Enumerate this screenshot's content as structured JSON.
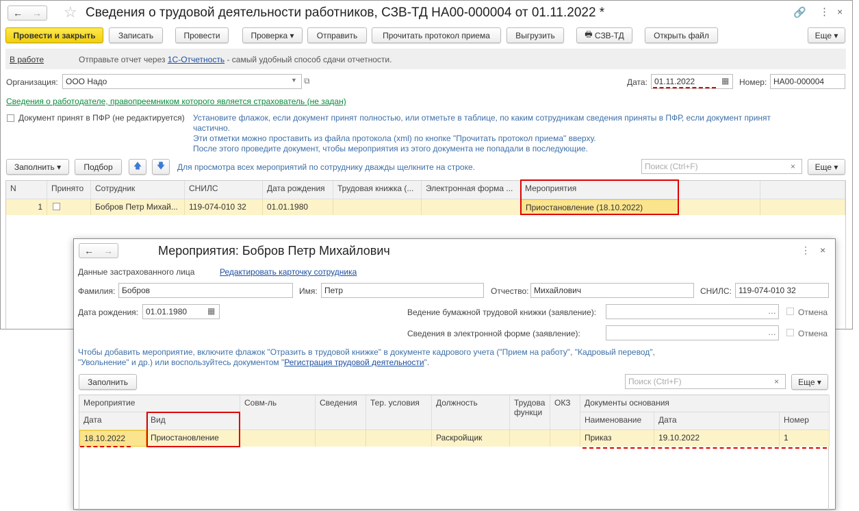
{
  "window": {
    "title": "Сведения о трудовой деятельности работников, СЗВ-ТД НА00-000004 от 01.11.2022 *"
  },
  "toolbar": {
    "post_close": "Провести и закрыть",
    "save": "Записать",
    "post": "Провести",
    "check": "Проверка",
    "send": "Отправить",
    "read_protocol": "Прочитать протокол приема",
    "upload": "Выгрузить",
    "print": "СЗВ-ТД",
    "open_file": "Открыть файл",
    "more": "Еще"
  },
  "status": {
    "state": "В работе",
    "msg_pre": "Отправьте отчет через",
    "msg_link": "1С-Отчетность",
    "msg_post": "- самый удобный способ сдачи отчетности."
  },
  "form": {
    "org_label": "Организация:",
    "org_value": "ООО Надо",
    "date_label": "Дата:",
    "date_value": "01.11.2022",
    "num_label": "Номер:",
    "num_value": "НА00-000004",
    "employer_link": "Сведения о работодателе, правопреемником которого является страхователь (не задан)",
    "accepted_label": "Документ принят в ПФР (не редактируется)",
    "hint1": "Установите флажок, если документ принят полностью, или отметьте в таблице, по каким сотрудникам сведения приняты в ПФР, если документ принят",
    "hint1b": "частично.",
    "hint2": "Эти отметки можно проставить из файла протокола (xml) по кнопке \"Прочитать протокол приема\" вверху.",
    "hint3": "После этого проведите документ, чтобы мероприятия из этого документа не попадали в последующие."
  },
  "table_toolbar": {
    "fill": "Заполнить",
    "select": "Подбор",
    "hint": "Для просмотра всех мероприятий по сотруднику дважды щелкните на строке.",
    "search_placeholder": "Поиск (Ctrl+F)",
    "more": "Еще"
  },
  "table": {
    "headers": [
      "N",
      "Принято",
      "Сотрудник",
      "СНИЛС",
      "Дата рождения",
      "Трудовая книжка (...",
      "Электронная форма ...",
      "Мероприятия"
    ],
    "rows": [
      {
        "n": "1",
        "employee": "Бобров Петр Михай...",
        "snils": "119-074-010 32",
        "birth": "01.01.1980",
        "book": "",
        "eform": "",
        "events": "Приостановление (18.10.2022)"
      }
    ]
  },
  "dialog": {
    "title": "Мероприятия: Бобров Петр Михайлович",
    "section": "Данные застрахованного лица",
    "edit_link": "Редактировать карточку сотрудника",
    "surname_label": "Фамилия:",
    "surname": "Бобров",
    "name_label": "Имя:",
    "name": "Петр",
    "patronymic_label": "Отчество:",
    "patronymic": "Михайлович",
    "snils_label": "СНИЛС:",
    "snils": "119-074-010 32",
    "birth_label": "Дата рождения:",
    "birth": "01.01.1980",
    "paper_label": "Ведение бумажной трудовой книжки (заявление):",
    "eform_label": "Сведения в электронной форме (заявление):",
    "cancel": "Отмена",
    "hint_a": "Чтобы добавить мероприятие, включите флажок \"Отразить в трудовой книжке\" в документе кадрового учета (\"Прием на работу\", \"Кадровый перевод\",",
    "hint_b": "\"Увольнение\" и др.) или воспользуйтесь документом \"",
    "hint_link": "Регистрация трудовой деятельности",
    "hint_c": "\".",
    "fill": "Заполнить",
    "search_placeholder": "Поиск (Ctrl+F)",
    "more": "Еще",
    "headers": {
      "event": "Мероприятие",
      "date": "Дата",
      "kind": "Вид",
      "combo": "Совм-ль",
      "info": "Сведения",
      "terr": "Тер. условия",
      "position": "Должность",
      "func": "Трудова функци",
      "okz": "ОКЗ",
      "docs": "Документы основания",
      "doc_name": "Наименование",
      "doc_date": "Дата",
      "doc_num": "Номер"
    },
    "row": {
      "date": "18.10.2022",
      "kind": "Приостановление",
      "position": "Раскройщик",
      "doc_name": "Приказ",
      "doc_date": "19.10.2022",
      "doc_num": "1"
    }
  }
}
